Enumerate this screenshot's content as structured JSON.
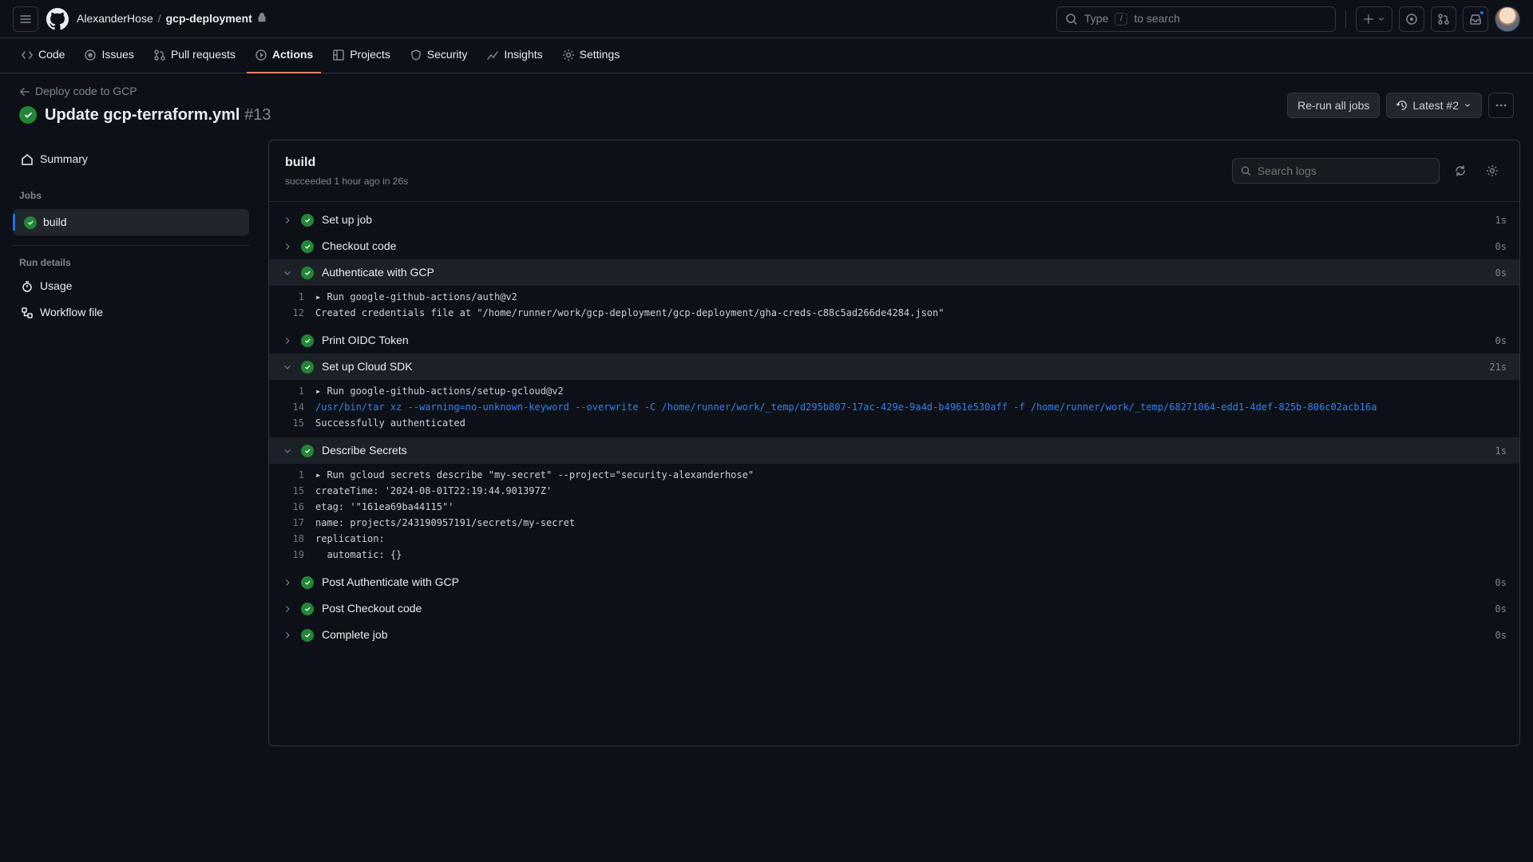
{
  "breadcrumb": {
    "owner": "AlexanderHose",
    "repo": "gcp-deployment"
  },
  "search": {
    "placeholder": "Type",
    "suffix": "to search"
  },
  "tabs": {
    "code": "Code",
    "issues": "Issues",
    "pulls": "Pull requests",
    "actions": "Actions",
    "projects": "Projects",
    "security": "Security",
    "insights": "Insights",
    "settings": "Settings"
  },
  "run": {
    "back": "Deploy code to GCP",
    "title": "Update gcp-terraform.yml",
    "number": "#13",
    "rerun_btn": "Re-run all jobs",
    "attempt_btn": "Latest #2"
  },
  "sidebar": {
    "summary": "Summary",
    "jobs_title": "Jobs",
    "job_name": "build",
    "rundetails_title": "Run details",
    "usage": "Usage",
    "workflow_file": "Workflow file"
  },
  "panel": {
    "title": "build",
    "subtitle": "succeeded 1 hour ago in 26s",
    "search_placeholder": "Search logs"
  },
  "steps": [
    {
      "name": "Set up job",
      "dur": "1s",
      "expanded": false
    },
    {
      "name": "Checkout code",
      "dur": "0s",
      "expanded": false
    },
    {
      "name": "Authenticate with GCP",
      "dur": "0s",
      "expanded": true,
      "lines": [
        {
          "ln": "1",
          "cls": "cmd",
          "txt": "Run google-github-actions/auth@v2"
        },
        {
          "ln": "12",
          "cls": "",
          "txt": "Created credentials file at \"/home/runner/work/gcp-deployment/gcp-deployment/gha-creds-c88c5ad266de4284.json\""
        }
      ]
    },
    {
      "name": "Print OIDC Token",
      "dur": "0s",
      "expanded": false
    },
    {
      "name": "Set up Cloud SDK",
      "dur": "21s",
      "expanded": true,
      "lines": [
        {
          "ln": "1",
          "cls": "cmd",
          "txt": "Run google-github-actions/setup-gcloud@v2"
        },
        {
          "ln": "14",
          "cls": "blue",
          "txt": "/usr/bin/tar xz --warning=no-unknown-keyword --overwrite -C /home/runner/work/_temp/d295b807-17ac-429e-9a4d-b4961e530aff -f /home/runner/work/_temp/68271064-edd1-4def-825b-806c02acb16a"
        },
        {
          "ln": "15",
          "cls": "",
          "txt": "Successfully authenticated"
        }
      ]
    },
    {
      "name": "Describe Secrets",
      "dur": "1s",
      "expanded": true,
      "lines": [
        {
          "ln": "1",
          "cls": "cmd",
          "txt": "Run gcloud secrets describe \"my-secret\" --project=\"security-alexanderhose\""
        },
        {
          "ln": "15",
          "cls": "",
          "txt": "createTime: '2024-08-01T22:19:44.901397Z'"
        },
        {
          "ln": "16",
          "cls": "",
          "txt": "etag: '\"161ea69ba44115\"'"
        },
        {
          "ln": "17",
          "cls": "",
          "txt": "name: projects/243190957191/secrets/my-secret"
        },
        {
          "ln": "18",
          "cls": "",
          "txt": "replication:"
        },
        {
          "ln": "19",
          "cls": "",
          "txt": "  automatic: {}"
        }
      ]
    },
    {
      "name": "Post Authenticate with GCP",
      "dur": "0s",
      "expanded": false
    },
    {
      "name": "Post Checkout code",
      "dur": "0s",
      "expanded": false
    },
    {
      "name": "Complete job",
      "dur": "0s",
      "expanded": false
    }
  ]
}
